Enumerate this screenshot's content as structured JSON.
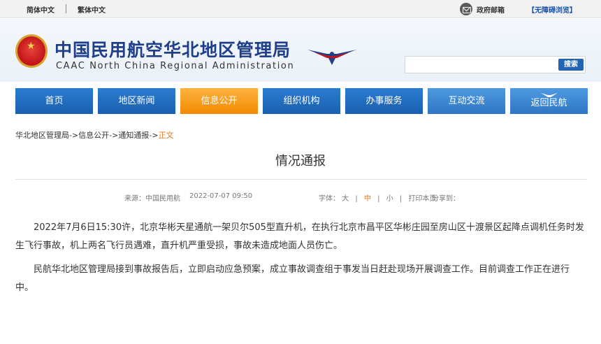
{
  "topbar": {
    "simplified": "简体中文",
    "traditional": "繁体中文",
    "mail": "政府邮箱",
    "accessible": "【无障碍浏览】"
  },
  "header": {
    "title_cn": "中国民用航空华北地区管理局",
    "title_en": "CAAC North China Regional Administration",
    "search_placeholder": "",
    "search_button": "搜索"
  },
  "nav": {
    "items": [
      {
        "label": "首页"
      },
      {
        "label": "地区新闻"
      },
      {
        "label": "信息公开"
      },
      {
        "label": "组织机构"
      },
      {
        "label": "办事服务"
      },
      {
        "label": "互动交流"
      },
      {
        "label": "返回民航"
      }
    ],
    "active_index": 2
  },
  "breadcrumb": {
    "items": [
      "华北地区管理局",
      "信息公开",
      "通知通报"
    ],
    "separator": "->",
    "current": "正文"
  },
  "article": {
    "title": "情况通报",
    "source_label": "来源：",
    "source": "中国民用航",
    "date": "2022-07-07 09:50",
    "font_label": "字体：",
    "font_large": "大",
    "font_medium": "中",
    "font_small": "小",
    "bar": "|",
    "print": "打印本页",
    "share": "分享到：",
    "paragraphs": [
      "2022年7月6日15:30许，北京华彬天星通航一架贝尔505型直升机，在执行北京市昌平区华彬庄园至房山区十渡景区起降点调机任务时发生飞行事故，机上两名飞行员遇难，直升机严重受损，事故未造成地面人员伤亡。",
      "民航华北地区管理局接到事故报告后，立即启动应急预案，成立事故调查组于事发当日赶赴现场开展调查工作。目前调查工作正在进行中。"
    ]
  },
  "colors": {
    "nav_blue": "#1a5fb0",
    "nav_active": "#f08a00",
    "title_blue": "#1f3f8a",
    "accent_orange": "#e5761b"
  }
}
